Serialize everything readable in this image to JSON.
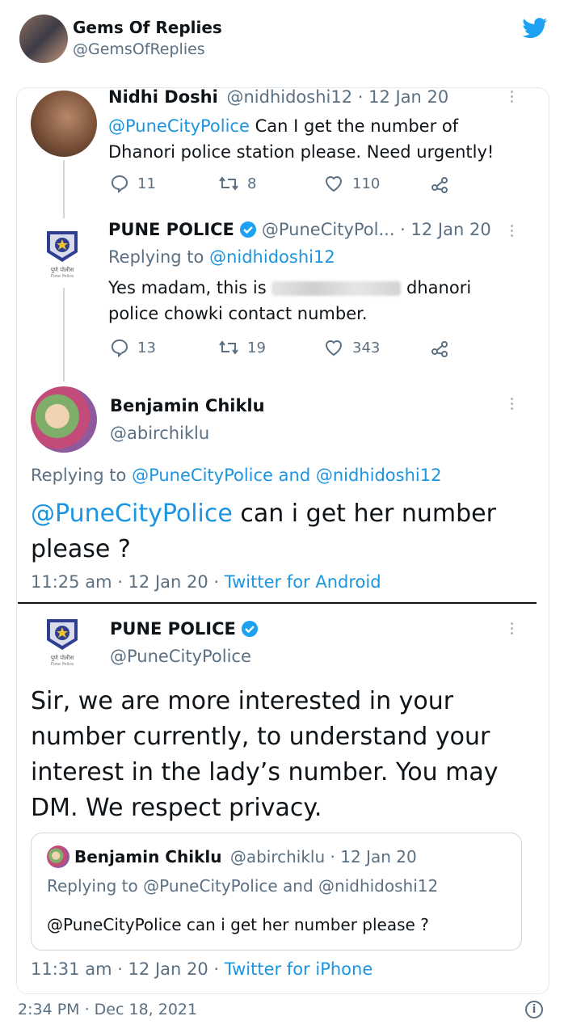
{
  "header": {
    "name": "Gems Of Replies",
    "handle": "@GemsOfReplies",
    "logo_icon": "twitter-bird-icon"
  },
  "tweet1": {
    "name": "Nidhi Doshi",
    "meta": "@nidhidoshi12 · 12 Jan 20",
    "mention": "@PuneCityPolice",
    "text_line1": " Can I get the number of",
    "text_line2": "Dhanori police station please. Need urgently!",
    "replies": "11",
    "retweets": "8",
    "likes": "110"
  },
  "tweet2": {
    "name": "PUNE POLICE",
    "handle_date": "@PuneCityPol...  · 12 Jan 20",
    "replying_prefix": "Replying to ",
    "replying_to": "@nidhidoshi12",
    "text_line1_a": "Yes madam, this is ",
    "text_line1_b": " dhanori",
    "text_line2": "police chowki contact number.",
    "replies": "13",
    "retweets": "19",
    "likes": "343"
  },
  "tweet3": {
    "name": "Benjamin Chiklu",
    "handle": "@abirchiklu",
    "replying_prefix": "Replying to ",
    "replying_to": "@PuneCityPolice and @nidhidoshi12",
    "mention": "@PuneCityPolice",
    "text_line1": " can i get her number",
    "text_line2": "please ?",
    "time_date": "11:25 am · 12 Jan 20 · ",
    "source": "Twitter for Android"
  },
  "tweet4": {
    "name": "PUNE POLICE",
    "handle": "@PuneCityPolice",
    "text_line1": "Sir, we are more interested in your",
    "text_line2": "number currently, to understand your",
    "text_line3": "interest in the lady’s number. You may",
    "text_line4": "DM. We respect privacy.",
    "quote": {
      "name": "Benjamin Chiklu",
      "meta": "@abirchiklu · 12 Jan 20",
      "replying": "Replying to @PuneCityPolice and @nidhidoshi12",
      "text": "@PuneCityPolice can i get her number please ?"
    },
    "time_date": "11:31 am · 12 Jan 20 · ",
    "source": "Twitter for iPhone"
  },
  "footer": {
    "timestamp": "2:34 PM · Dec 18, 2021"
  },
  "seal_text": "पुणे पोलीस",
  "seal_sub": "Pune Police",
  "colors": {
    "accent": "#1b95e0",
    "text": "#0f1419",
    "muted": "#5b7083",
    "border": "#e1e8ed"
  }
}
